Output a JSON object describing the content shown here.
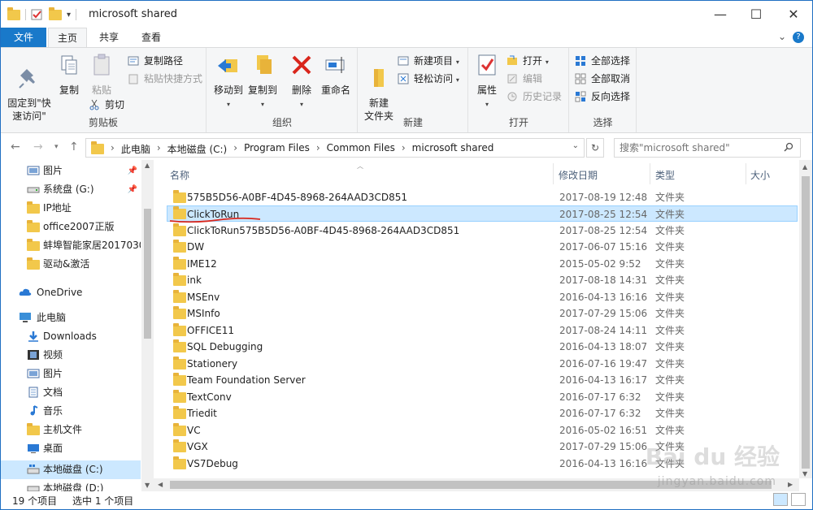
{
  "window": {
    "title": "microsoft shared"
  },
  "tabs": [
    {
      "label": "文件"
    },
    {
      "label": "主页"
    },
    {
      "label": "共享"
    },
    {
      "label": "查看"
    }
  ],
  "ribbon": {
    "clipboard": {
      "label": "剪贴板",
      "pin": "固定到\"快\n速访问\"",
      "copy": "复制",
      "paste": "粘贴",
      "copy_path": "复制路径",
      "paste_shortcut": "粘贴快捷方式",
      "cut": "剪切"
    },
    "organize": {
      "label": "组织",
      "move_to": "移动到",
      "copy_to": "复制到",
      "delete": "删除",
      "rename": "重命名"
    },
    "new": {
      "label": "新建",
      "new_folder": "新建\n文件夹",
      "new_item": "新建项目",
      "easy_access": "轻松访问"
    },
    "open": {
      "label": "打开",
      "properties": "属性",
      "open": "打开",
      "edit": "编辑",
      "history": "历史记录"
    },
    "select": {
      "label": "选择",
      "select_all": "全部选择",
      "select_none": "全部取消",
      "invert": "反向选择"
    }
  },
  "address": {
    "crumbs": [
      "此电脑",
      "本地磁盘 (C:)",
      "Program Files",
      "Common Files",
      "microsoft shared"
    ],
    "search_placeholder": "搜索\"microsoft shared\""
  },
  "nav": {
    "items": [
      {
        "label": "图片",
        "pinned": true
      },
      {
        "label": "系统盘 (G:)",
        "pinned": true
      },
      {
        "label": "IP地址"
      },
      {
        "label": "office2007正版"
      },
      {
        "label": "蚌埠智能家居2017030"
      },
      {
        "label": "驱动&激活"
      },
      {
        "label": "OneDrive"
      },
      {
        "label": "此电脑"
      },
      {
        "label": "Downloads"
      },
      {
        "label": "视频"
      },
      {
        "label": "图片"
      },
      {
        "label": "文档"
      },
      {
        "label": "音乐"
      },
      {
        "label": "主机文件"
      },
      {
        "label": "桌面"
      },
      {
        "label": "本地磁盘 (C:)"
      },
      {
        "label": "本地磁盘 (D:)"
      }
    ]
  },
  "list": {
    "columns": {
      "name": "名称",
      "date": "修改日期",
      "type": "类型",
      "size": "大小"
    },
    "rows": [
      {
        "name": "575B5D56-A0BF-4D45-8968-264AAD3CD851",
        "date": "2017-08-19 12:48",
        "type": "文件夹"
      },
      {
        "name": "ClickToRun",
        "date": "2017-08-25 12:54",
        "type": "文件夹",
        "selected": true
      },
      {
        "name": "ClickToRun575B5D56-A0BF-4D45-8968-264AAD3CD851",
        "date": "2017-08-25 12:54",
        "type": "文件夹"
      },
      {
        "name": "DW",
        "date": "2017-06-07 15:16",
        "type": "文件夹"
      },
      {
        "name": "IME12",
        "date": "2015-05-02 9:52",
        "type": "文件夹"
      },
      {
        "name": "ink",
        "date": "2017-08-18 14:31",
        "type": "文件夹"
      },
      {
        "name": "MSEnv",
        "date": "2016-04-13 16:16",
        "type": "文件夹"
      },
      {
        "name": "MSInfo",
        "date": "2017-07-29 15:06",
        "type": "文件夹"
      },
      {
        "name": "OFFICE11",
        "date": "2017-08-24 14:11",
        "type": "文件夹"
      },
      {
        "name": "SQL Debugging",
        "date": "2016-04-13 18:07",
        "type": "文件夹"
      },
      {
        "name": "Stationery",
        "date": "2016-07-16 19:47",
        "type": "文件夹"
      },
      {
        "name": "Team Foundation Server",
        "date": "2016-04-13 16:17",
        "type": "文件夹"
      },
      {
        "name": "TextConv",
        "date": "2016-07-17 6:32",
        "type": "文件夹"
      },
      {
        "name": "Triedit",
        "date": "2016-07-17 6:32",
        "type": "文件夹"
      },
      {
        "name": "VC",
        "date": "2016-05-02 16:51",
        "type": "文件夹"
      },
      {
        "name": "VGX",
        "date": "2017-07-29 15:06",
        "type": "文件夹"
      },
      {
        "name": "VS7Debug",
        "date": "2016-04-13 16:16",
        "type": "文件夹"
      }
    ]
  },
  "status": {
    "count": "19 个项目",
    "selected": "选中 1 个项目"
  },
  "watermark": {
    "brand": "Bai du 经验",
    "url": "jingyan.baidu.com"
  },
  "colors": {
    "accent": "#1979ca",
    "selection": "#cce8ff",
    "folder": "#f2c84b"
  }
}
